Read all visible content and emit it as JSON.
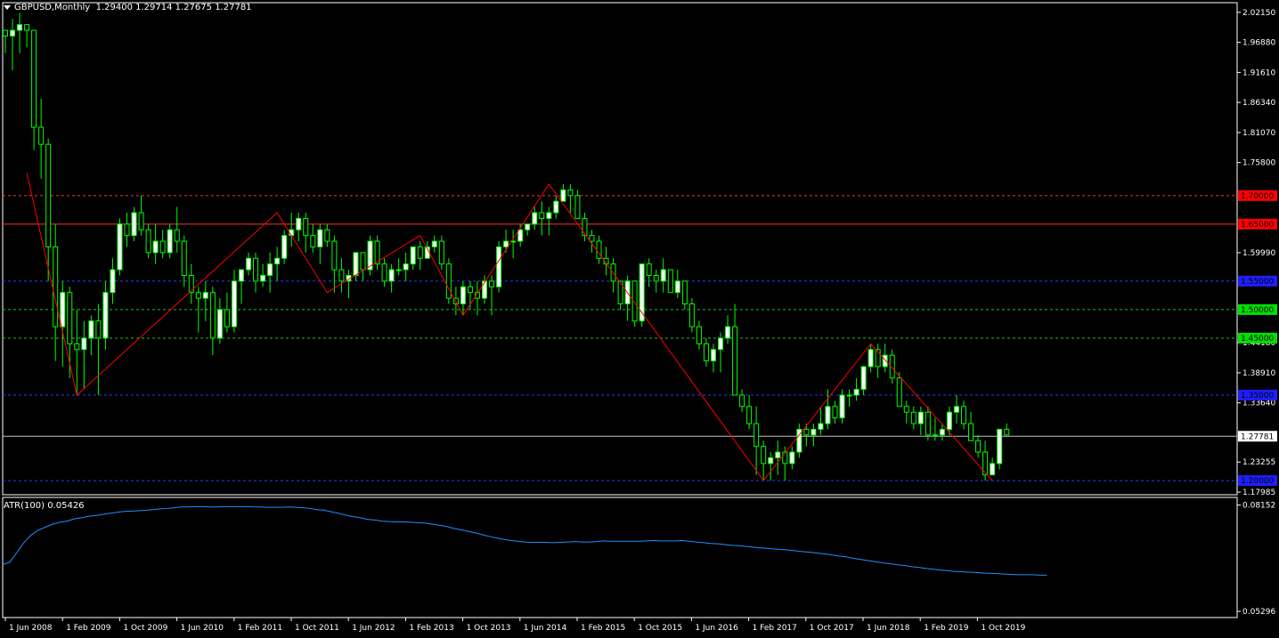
{
  "header": {
    "symbol": "GBPUSD,Monthly",
    "ohlc": "1.29400 1.29714 1.27675 1.27781"
  },
  "indicator": {
    "label": "ATR(100) 0.05426"
  },
  "colors": {
    "background": "#000000",
    "bull_candle": "#ffffff",
    "bear_candle": "#000000",
    "wick": "#00ff00",
    "zigzag": "#ff0000",
    "atr_line": "#1e90ff",
    "grid_frame": "#ffffff"
  },
  "chart_data": [
    {
      "type": "candlestick",
      "timeframe": "Monthly",
      "symbol": "GBPUSD",
      "price_ticks": [
        "2.02150",
        "1.96880",
        "1.91610",
        "1.86340",
        "1.81070",
        "1.75800",
        "1.59990",
        "1.44180",
        "1.38910",
        "1.33640",
        "1.23255",
        "1.17985"
      ],
      "ylim": [
        1.17985,
        2.0338
      ],
      "x_ticks": [
        "1 Jun 2008",
        "1 Feb 2009",
        "1 Oct 2009",
        "1 Jun 2010",
        "1 Feb 2011",
        "1 Oct 2011",
        "1 Jun 2012",
        "1 Feb 2013",
        "1 Oct 2013",
        "1 Jun 2014",
        "1 Feb 2015",
        "1 Oct 2015",
        "1 Jun 2016",
        "1 Feb 2017",
        "1 Oct 2017",
        "1 Jun 2018",
        "1 Feb 2019",
        "1 Oct 2019"
      ],
      "horizontal_lines": [
        {
          "price": 1.7,
          "label": "1.70000",
          "style": "dashed",
          "color": "#ff3030",
          "label_bg": "#ff0000",
          "label_fg": "#000000"
        },
        {
          "price": 1.65,
          "label": "1.65000",
          "style": "solid",
          "color": "#ff3030",
          "label_bg": "#ff0000",
          "label_fg": "#000000"
        },
        {
          "price": 1.55,
          "label": "1.55000",
          "style": "dashed",
          "color": "#2040ff",
          "label_bg": "#1e1eff",
          "label_fg": "#000000"
        },
        {
          "price": 1.5,
          "label": "1.50000",
          "style": "dashed",
          "color": "#20c020",
          "label_bg": "#00e000",
          "label_fg": "#000000"
        },
        {
          "price": 1.45,
          "label": "1.45000",
          "style": "dashed",
          "color": "#20c020",
          "label_bg": "#00e000",
          "label_fg": "#000000"
        },
        {
          "price": 1.35,
          "label": "1.35000",
          "style": "dashed",
          "color": "#2040ff",
          "label_bg": "#1e1eff",
          "label_fg": "#000000"
        },
        {
          "price": 1.27781,
          "label": "1.27781",
          "style": "solid",
          "color": "#c0c0c0",
          "label_bg": "#ffffff",
          "label_fg": "#000000"
        },
        {
          "price": 1.2,
          "label": "1.20000",
          "style": "dashed",
          "color": "#2040ff",
          "label_bg": "#1e1eff",
          "label_fg": "#000000"
        }
      ],
      "zigzag": [
        {
          "date": "2008-06",
          "price": 1.74
        },
        {
          "date": "2009-01",
          "price": 1.35
        },
        {
          "date": "2011-05",
          "price": 1.67
        },
        {
          "date": "2011-12",
          "price": 1.53
        },
        {
          "date": "2013-01",
          "price": 1.63
        },
        {
          "date": "2013-07",
          "price": 1.49
        },
        {
          "date": "2014-07",
          "price": 1.72
        },
        {
          "date": "2017-01",
          "price": 1.2
        },
        {
          "date": "2018-04",
          "price": 1.44
        },
        {
          "date": "2019-09",
          "price": 1.2
        }
      ],
      "candles": [
        [
          1.99,
          1.99,
          1.95,
          1.98
        ],
        [
          1.98,
          2.01,
          1.92,
          1.99
        ],
        [
          1.99,
          2.02,
          1.95,
          2.0
        ],
        [
          2.0,
          2.0,
          1.96,
          1.99
        ],
        [
          1.99,
          1.99,
          1.78,
          1.82
        ],
        [
          1.82,
          1.87,
          1.73,
          1.79
        ],
        [
          1.79,
          1.8,
          1.55,
          1.61
        ],
        [
          1.61,
          1.65,
          1.41,
          1.47
        ],
        [
          1.47,
          1.55,
          1.4,
          1.53
        ],
        [
          1.53,
          1.54,
          1.38,
          1.44
        ],
        [
          1.44,
          1.5,
          1.35,
          1.43
        ],
        [
          1.43,
          1.48,
          1.36,
          1.45
        ],
        [
          1.45,
          1.49,
          1.42,
          1.48
        ],
        [
          1.48,
          1.51,
          1.35,
          1.45
        ],
        [
          1.45,
          1.55,
          1.43,
          1.53
        ],
        [
          1.53,
          1.59,
          1.51,
          1.57
        ],
        [
          1.57,
          1.66,
          1.56,
          1.65
        ],
        [
          1.65,
          1.67,
          1.61,
          1.63
        ],
        [
          1.63,
          1.68,
          1.62,
          1.67
        ],
        [
          1.67,
          1.7,
          1.63,
          1.64
        ],
        [
          1.64,
          1.65,
          1.59,
          1.6
        ],
        [
          1.6,
          1.65,
          1.58,
          1.62
        ],
        [
          1.62,
          1.64,
          1.59,
          1.6
        ],
        [
          1.6,
          1.65,
          1.59,
          1.64
        ],
        [
          1.64,
          1.68,
          1.6,
          1.62
        ],
        [
          1.62,
          1.63,
          1.54,
          1.56
        ],
        [
          1.56,
          1.58,
          1.51,
          1.53
        ],
        [
          1.53,
          1.54,
          1.46,
          1.52
        ],
        [
          1.52,
          1.55,
          1.48,
          1.53
        ],
        [
          1.53,
          1.54,
          1.42,
          1.45
        ],
        [
          1.45,
          1.52,
          1.44,
          1.5
        ],
        [
          1.5,
          1.53,
          1.46,
          1.47
        ],
        [
          1.47,
          1.57,
          1.46,
          1.55
        ],
        [
          1.55,
          1.57,
          1.51,
          1.57
        ],
        [
          1.57,
          1.6,
          1.56,
          1.59
        ],
        [
          1.59,
          1.6,
          1.53,
          1.55
        ],
        [
          1.55,
          1.58,
          1.54,
          1.56
        ],
        [
          1.56,
          1.6,
          1.53,
          1.58
        ],
        [
          1.58,
          1.61,
          1.55,
          1.59
        ],
        [
          1.59,
          1.64,
          1.58,
          1.63
        ],
        [
          1.63,
          1.67,
          1.61,
          1.64
        ],
        [
          1.64,
          1.67,
          1.62,
          1.66
        ],
        [
          1.66,
          1.67,
          1.6,
          1.63
        ],
        [
          1.63,
          1.65,
          1.6,
          1.61
        ],
        [
          1.61,
          1.65,
          1.58,
          1.64
        ],
        [
          1.64,
          1.65,
          1.61,
          1.62
        ],
        [
          1.62,
          1.63,
          1.53,
          1.57
        ],
        [
          1.57,
          1.59,
          1.53,
          1.55
        ],
        [
          1.55,
          1.57,
          1.52,
          1.56
        ],
        [
          1.56,
          1.6,
          1.55,
          1.6
        ],
        [
          1.6,
          1.6,
          1.55,
          1.57
        ],
        [
          1.57,
          1.63,
          1.56,
          1.62
        ],
        [
          1.62,
          1.63,
          1.57,
          1.58
        ],
        [
          1.58,
          1.59,
          1.54,
          1.55
        ],
        [
          1.55,
          1.58,
          1.53,
          1.57
        ],
        [
          1.57,
          1.59,
          1.56,
          1.57
        ],
        [
          1.57,
          1.6,
          1.55,
          1.58
        ],
        [
          1.58,
          1.61,
          1.57,
          1.61
        ],
        [
          1.61,
          1.62,
          1.57,
          1.59
        ],
        [
          1.59,
          1.62,
          1.59,
          1.61
        ],
        [
          1.61,
          1.63,
          1.6,
          1.62
        ],
        [
          1.62,
          1.63,
          1.57,
          1.58
        ],
        [
          1.58,
          1.59,
          1.51,
          1.52
        ],
        [
          1.52,
          1.54,
          1.49,
          1.51
        ],
        [
          1.51,
          1.55,
          1.49,
          1.54
        ],
        [
          1.54,
          1.55,
          1.5,
          1.53
        ],
        [
          1.53,
          1.55,
          1.49,
          1.52
        ],
        [
          1.52,
          1.56,
          1.51,
          1.55
        ],
        [
          1.55,
          1.56,
          1.49,
          1.54
        ],
        [
          1.54,
          1.62,
          1.53,
          1.61
        ],
        [
          1.61,
          1.64,
          1.6,
          1.62
        ],
        [
          1.62,
          1.64,
          1.59,
          1.62
        ],
        [
          1.62,
          1.65,
          1.61,
          1.64
        ],
        [
          1.64,
          1.65,
          1.63,
          1.65
        ],
        [
          1.65,
          1.68,
          1.64,
          1.67
        ],
        [
          1.67,
          1.69,
          1.63,
          1.66
        ],
        [
          1.66,
          1.68,
          1.63,
          1.67
        ],
        [
          1.67,
          1.7,
          1.66,
          1.69
        ],
        [
          1.69,
          1.72,
          1.69,
          1.71
        ],
        [
          1.71,
          1.72,
          1.67,
          1.7
        ],
        [
          1.7,
          1.71,
          1.66,
          1.66
        ],
        [
          1.66,
          1.67,
          1.62,
          1.63
        ],
        [
          1.63,
          1.64,
          1.6,
          1.62
        ],
        [
          1.62,
          1.63,
          1.58,
          1.59
        ],
        [
          1.59,
          1.61,
          1.56,
          1.58
        ],
        [
          1.58,
          1.59,
          1.53,
          1.55
        ],
        [
          1.55,
          1.55,
          1.5,
          1.51
        ],
        [
          1.51,
          1.56,
          1.48,
          1.55
        ],
        [
          1.55,
          1.55,
          1.47,
          1.48
        ],
        [
          1.48,
          1.58,
          1.47,
          1.58
        ],
        [
          1.58,
          1.59,
          1.54,
          1.56
        ],
        [
          1.56,
          1.57,
          1.53,
          1.55
        ],
        [
          1.55,
          1.59,
          1.53,
          1.57
        ],
        [
          1.57,
          1.57,
          1.53,
          1.53
        ],
        [
          1.53,
          1.57,
          1.52,
          1.55
        ],
        [
          1.55,
          1.55,
          1.5,
          1.51
        ],
        [
          1.51,
          1.52,
          1.46,
          1.47
        ],
        [
          1.47,
          1.48,
          1.43,
          1.44
        ],
        [
          1.44,
          1.45,
          1.4,
          1.41
        ],
        [
          1.41,
          1.44,
          1.39,
          1.43
        ],
        [
          1.43,
          1.46,
          1.39,
          1.45
        ],
        [
          1.45,
          1.49,
          1.44,
          1.47
        ],
        [
          1.47,
          1.51,
          1.41,
          1.35
        ],
        [
          1.35,
          1.36,
          1.32,
          1.33
        ],
        [
          1.33,
          1.35,
          1.29,
          1.3
        ],
        [
          1.3,
          1.33,
          1.21,
          1.26
        ],
        [
          1.26,
          1.27,
          1.2,
          1.23
        ],
        [
          1.23,
          1.25,
          1.2,
          1.24
        ],
        [
          1.24,
          1.27,
          1.21,
          1.25
        ],
        [
          1.25,
          1.26,
          1.2,
          1.23
        ],
        [
          1.23,
          1.26,
          1.22,
          1.25
        ],
        [
          1.25,
          1.3,
          1.24,
          1.29
        ],
        [
          1.29,
          1.3,
          1.26,
          1.28
        ],
        [
          1.28,
          1.3,
          1.26,
          1.29
        ],
        [
          1.29,
          1.33,
          1.28,
          1.3
        ],
        [
          1.3,
          1.36,
          1.29,
          1.33
        ],
        [
          1.33,
          1.34,
          1.3,
          1.31
        ],
        [
          1.31,
          1.36,
          1.3,
          1.35
        ],
        [
          1.35,
          1.36,
          1.33,
          1.35
        ],
        [
          1.35,
          1.38,
          1.34,
          1.36
        ],
        [
          1.36,
          1.4,
          1.35,
          1.4
        ],
        [
          1.4,
          1.44,
          1.39,
          1.43
        ],
        [
          1.43,
          1.44,
          1.38,
          1.4
        ],
        [
          1.4,
          1.44,
          1.39,
          1.42
        ],
        [
          1.42,
          1.43,
          1.37,
          1.38
        ],
        [
          1.38,
          1.39,
          1.33,
          1.33
        ],
        [
          1.33,
          1.34,
          1.3,
          1.32
        ],
        [
          1.32,
          1.33,
          1.29,
          1.3
        ],
        [
          1.3,
          1.33,
          1.28,
          1.32
        ],
        [
          1.32,
          1.33,
          1.27,
          1.28
        ],
        [
          1.28,
          1.31,
          1.27,
          1.28
        ],
        [
          1.28,
          1.3,
          1.27,
          1.29
        ],
        [
          1.29,
          1.33,
          1.28,
          1.32
        ],
        [
          1.32,
          1.35,
          1.3,
          1.33
        ],
        [
          1.33,
          1.34,
          1.29,
          1.3
        ],
        [
          1.3,
          1.32,
          1.27,
          1.27
        ],
        [
          1.27,
          1.28,
          1.24,
          1.25
        ],
        [
          1.25,
          1.27,
          1.2,
          1.21
        ],
        [
          1.21,
          1.24,
          1.21,
          1.23
        ],
        [
          1.23,
          1.29,
          1.22,
          1.29
        ],
        [
          1.29,
          1.3,
          1.28,
          1.28
        ]
      ]
    },
    {
      "type": "line",
      "name": "ATR(100)",
      "value_ticks": [
        "0.08152",
        "0.05296"
      ],
      "ylim": [
        0.0525,
        0.0819
      ],
      "values": [
        0.0655,
        0.0662,
        0.0688,
        0.0715,
        0.0735,
        0.0748,
        0.0756,
        0.0764,
        0.0769,
        0.0772,
        0.0778,
        0.0781,
        0.0785,
        0.0787,
        0.079,
        0.0793,
        0.0796,
        0.0798,
        0.0799,
        0.08,
        0.0801,
        0.0803,
        0.0805,
        0.0806,
        0.0808,
        0.081,
        0.081,
        0.0811,
        0.0811,
        0.081,
        0.081,
        0.0811,
        0.0811,
        0.0811,
        0.0811,
        0.081,
        0.081,
        0.0809,
        0.0809,
        0.0809,
        0.081,
        0.0809,
        0.0808,
        0.0806,
        0.0803,
        0.0801,
        0.0797,
        0.0793,
        0.0788,
        0.0784,
        0.0781,
        0.0777,
        0.0775,
        0.0772,
        0.0771,
        0.077,
        0.077,
        0.0769,
        0.0768,
        0.0767,
        0.0764,
        0.0761,
        0.0758,
        0.0753,
        0.0749,
        0.0745,
        0.0741,
        0.0736,
        0.0731,
        0.0727,
        0.0723,
        0.072,
        0.0718,
        0.0716,
        0.0715,
        0.0715,
        0.0715,
        0.0714,
        0.0715,
        0.0716,
        0.0717,
        0.0716,
        0.0716,
        0.0717,
        0.0719,
        0.0718,
        0.0718,
        0.0718,
        0.0718,
        0.0718,
        0.0719,
        0.072,
        0.0719,
        0.0719,
        0.0719,
        0.072,
        0.0718,
        0.0716,
        0.0714,
        0.0712,
        0.0711,
        0.0709,
        0.0707,
        0.0706,
        0.0704,
        0.0702,
        0.07,
        0.0699,
        0.0697,
        0.0696,
        0.0694,
        0.0692,
        0.069,
        0.0688,
        0.0686,
        0.0684,
        0.0681,
        0.0678,
        0.0676,
        0.0672,
        0.0669,
        0.0666,
        0.0663,
        0.066,
        0.0658,
        0.0655,
        0.0653,
        0.065,
        0.0648,
        0.0645,
        0.0643,
        0.0641,
        0.0639,
        0.0637,
        0.0636,
        0.0635,
        0.0634,
        0.0633,
        0.0632,
        0.0631,
        0.063,
        0.0629,
        0.0628,
        0.0628,
        0.0628,
        0.0627,
        0.0627
      ]
    }
  ]
}
